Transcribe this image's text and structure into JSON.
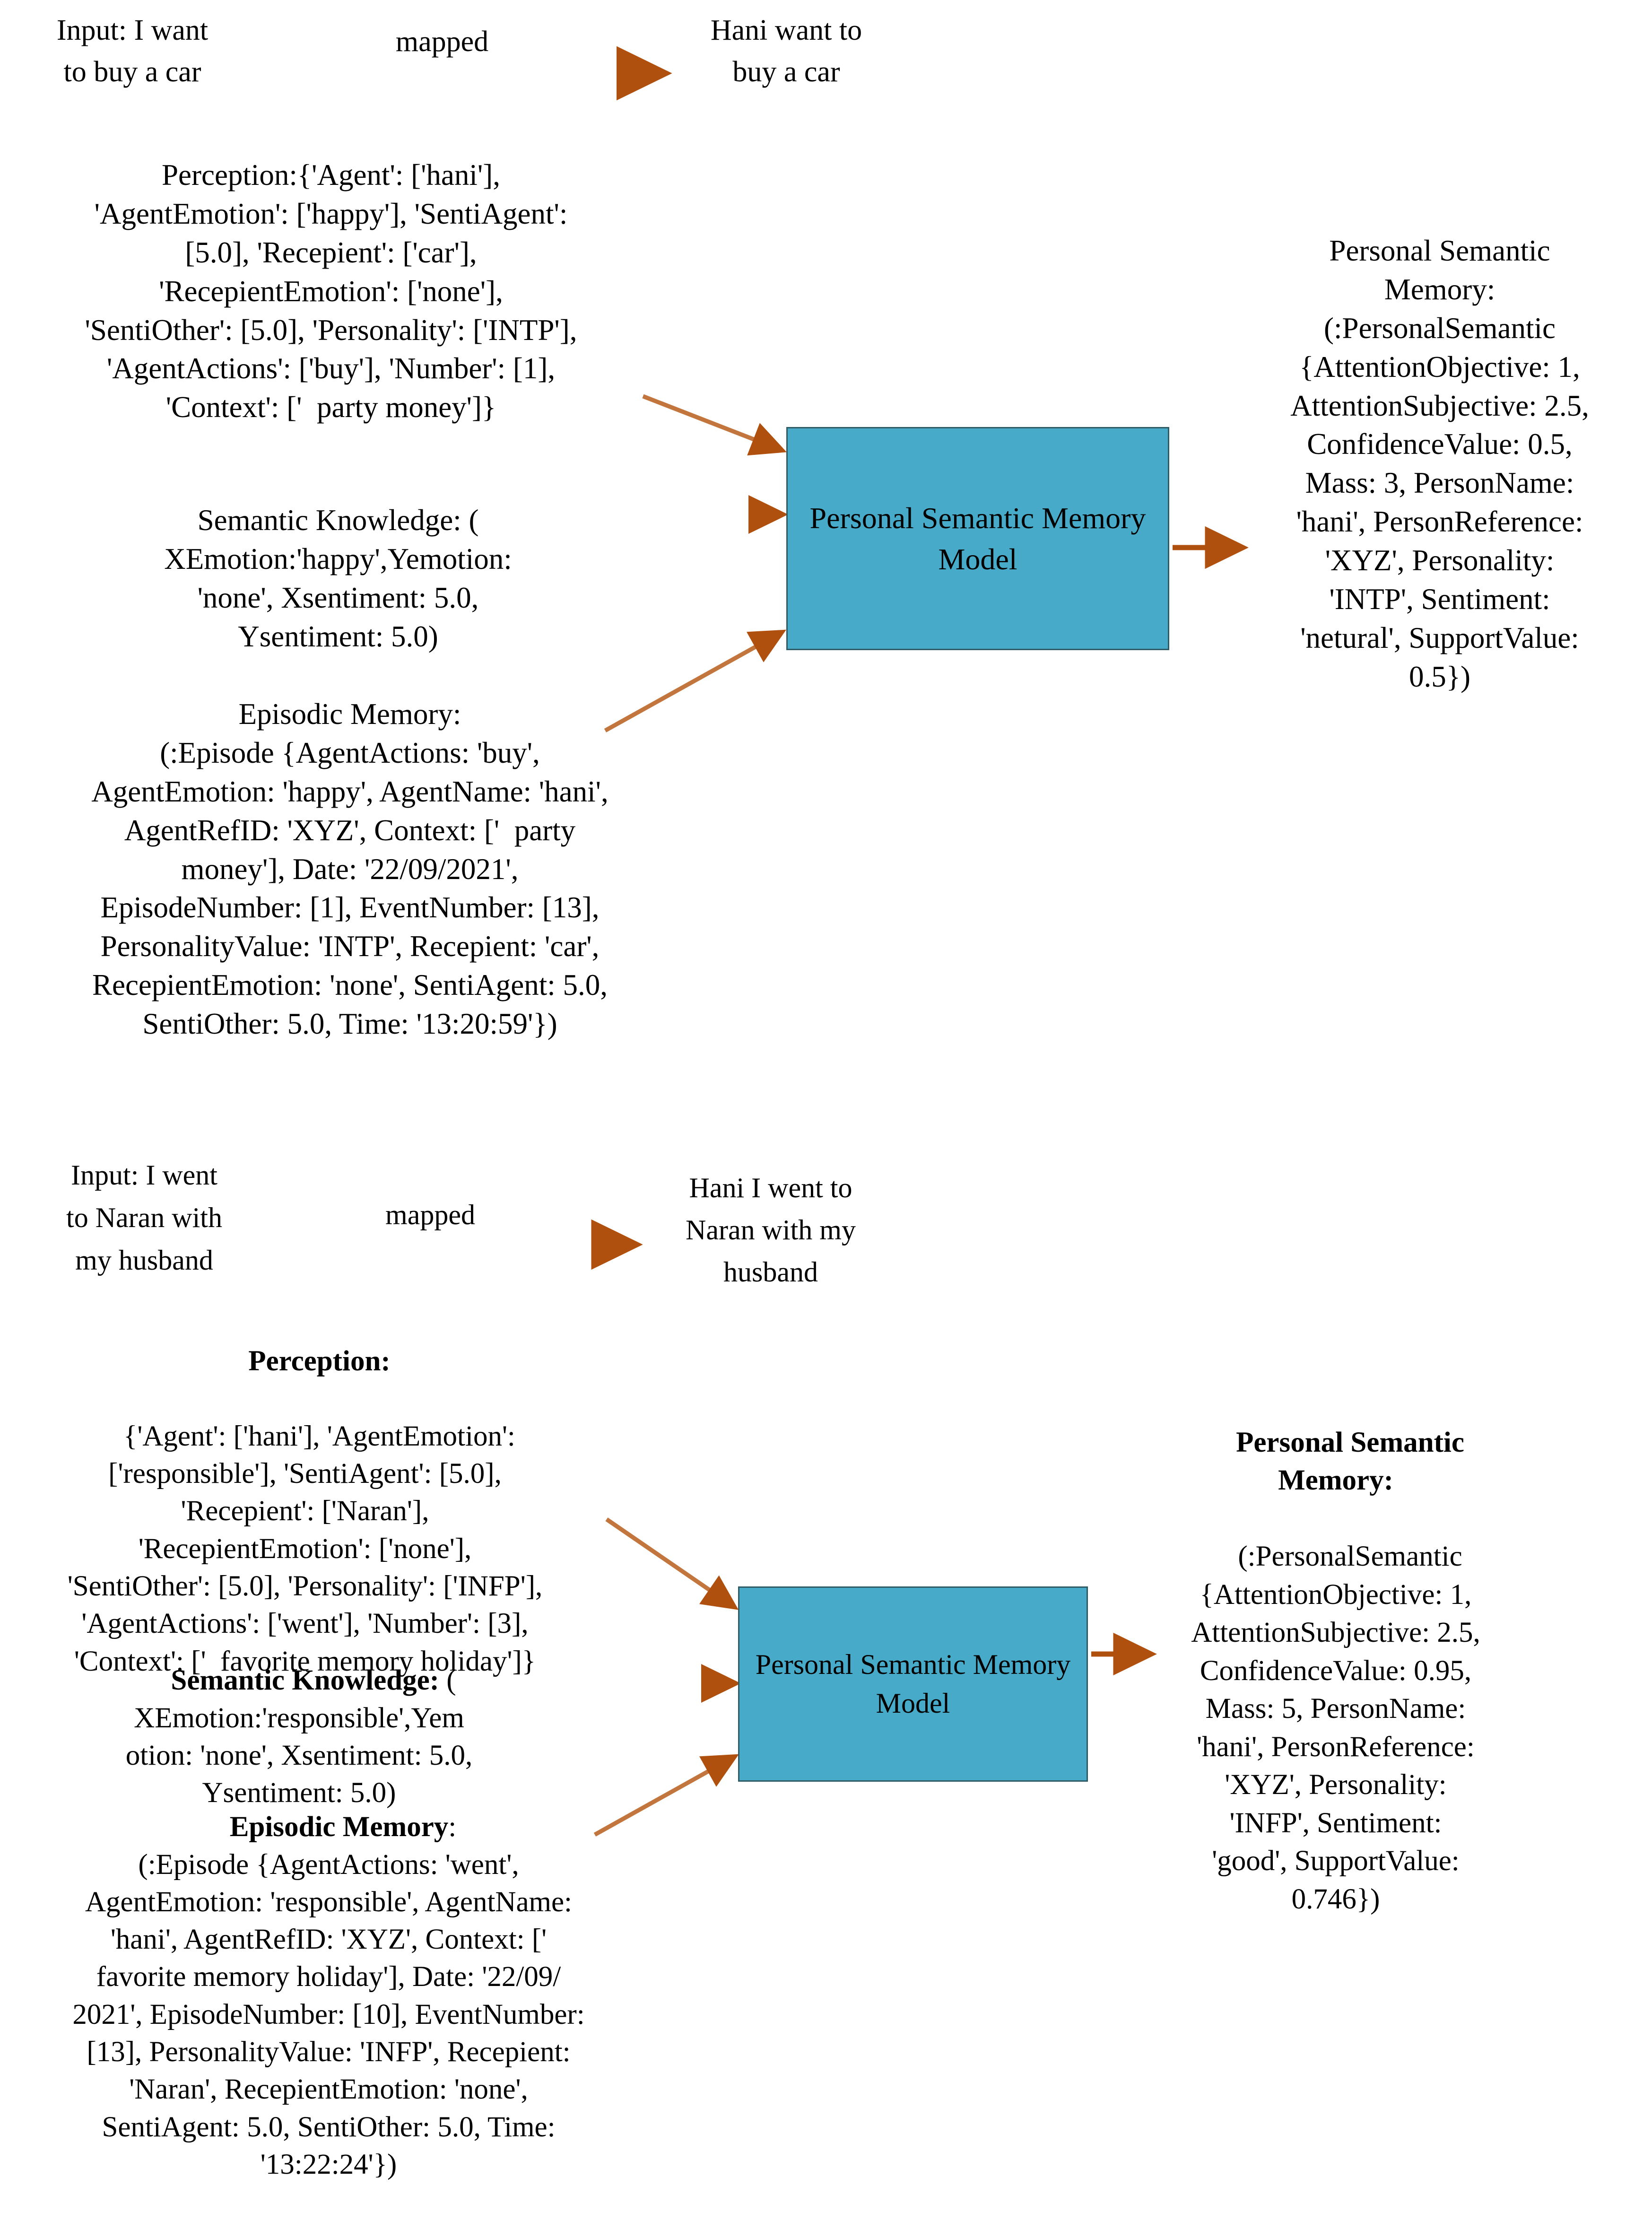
{
  "colors": {
    "model_box_fill": "#47AAC8",
    "model_box_border": "#2F5C66",
    "arrow": "#B0500F",
    "arrow_light": "#D99878",
    "text": "#000000",
    "background": "#FFFFFF"
  },
  "section1": {
    "input_text": "Input: I want\nto buy a car",
    "mapped_label": "mapped",
    "mapped_output": "Hani want to\nbuy a car",
    "perception": "Perception:{'Agent': ['hani'],\n'AgentEmotion': ['happy'], 'SentiAgent':\n[5.0], 'Recepient': ['car'],\n'RecepientEmotion': ['none'],\n'SentiOther': [5.0], 'Personality': ['INTP'],\n'AgentActions': ['buy'], 'Number': [1],\n'Context': ['  party money']}",
    "semantic_knowledge": "Semantic Knowledge: (\nXEmotion:'happy',Yemotion:\n'none', Xsentiment: 5.0,\nYsentiment: 5.0)",
    "episodic_memory": "Episodic Memory:\n(:Episode {AgentActions: 'buy',\nAgentEmotion: 'happy', AgentName: 'hani',\nAgentRefID: 'XYZ', Context: ['  party\nmoney'], Date: '22/09/2021',\nEpisodeNumber: [1], EventNumber: [13],\nPersonalityValue: 'INTP', Recepient: 'car',\nRecepientEmotion: 'none', SentiAgent: 5.0,\nSentiOther: 5.0, Time: '13:20:59'})",
    "model_label": "Personal Semantic\nMemory Model",
    "personal_semantic_memory": "Personal Semantic\nMemory:\n(:PersonalSemantic\n{AttentionObjective: 1,\nAttentionSubjective: 2.5,\nConfidenceValue: 0.5,\nMass: 3, PersonName:\n'hani', PersonReference:\n'XYZ', Personality:\n'INTP', Sentiment:\n'netural', SupportValue:\n0.5})"
  },
  "section2": {
    "input_text": "Input: I went\nto Naran with\nmy husband",
    "mapped_label": "mapped",
    "mapped_output": "Hani I went to\nNaran with my\nhusband",
    "perception_heading": "Perception:",
    "perception_body": "{'Agent': ['hani'], 'AgentEmotion':\n['responsible'], 'SentiAgent': [5.0],\n'Recepient': ['Naran'],\n'RecepientEmotion': ['none'],\n'SentiOther': [5.0], 'Personality': ['INFP'],\n'AgentActions': ['went'], 'Number': [3],\n'Context': ['  favorite memory holiday']}",
    "semantic_heading": "Semantic Knowledge:",
    "semantic_body": " (\nXEmotion:'responsible',Yem\notion: 'none', Xsentiment: 5.0,\nYsentiment: 5.0)",
    "episodic_heading": "Episodic Memory",
    "episodic_body": ":\n(:Episode {AgentActions: 'went',\nAgentEmotion: 'responsible', AgentName:\n'hani', AgentRefID: 'XYZ', Context: ['\nfavorite memory holiday'], Date: '22/09/\n2021', EpisodeNumber: [10], EventNumber:\n[13], PersonalityValue: 'INFP', Recepient:\n'Naran', RecepientEmotion: 'none',\nSentiAgent: 5.0, SentiOther: 5.0, Time:\n'13:22:24'})",
    "model_label": "Personal Semantic\nMemory Model",
    "psm_heading": "Personal Semantic\nMemory:",
    "psm_body": "(:PersonalSemantic\n{AttentionObjective: 1,\nAttentionSubjective: 2.5,\nConfidenceValue: 0.95,\nMass: 5, PersonName:\n'hani', PersonReference:\n'XYZ', Personality:\n'INFP', Sentiment:\n'good', SupportValue:\n0.746})"
  }
}
